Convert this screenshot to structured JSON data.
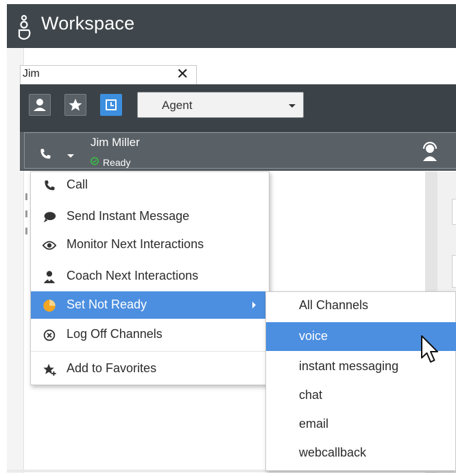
{
  "header": {
    "title": "Workspace",
    "logo_icon": "genesys-logo-icon"
  },
  "search": {
    "value": "Jim",
    "clear_label": "✕"
  },
  "team_communicator": {
    "buttons": [
      "contacts-icon",
      "favorites-icon",
      "recent-icon"
    ],
    "filter": {
      "selected": "Agent"
    }
  },
  "contact": {
    "name": "Jim Miller",
    "status": "Ready",
    "status_color": "#39b54a"
  },
  "context_menu": {
    "items": [
      {
        "label": "Call",
        "icon": "phone-icon"
      },
      {
        "label": "Send Instant Message",
        "icon": "chat-bubble-icon"
      },
      {
        "label": "Monitor Next Interactions",
        "icon": "eye-icon"
      },
      {
        "label": "Coach Next Interactions",
        "icon": "coach-icon"
      },
      {
        "label": "Set Not Ready",
        "icon": "not-ready-clock-icon",
        "highlighted": true
      },
      {
        "label": "Log Off Channels",
        "icon": "log-off-icon"
      },
      {
        "label": "Add to Favorites",
        "icon": "add-favorite-icon"
      }
    ]
  },
  "sub_menu": {
    "items": [
      "All Channels",
      "voice",
      "instant messaging",
      "chat",
      "email",
      "webcallback"
    ],
    "highlighted": "voice"
  },
  "colors": {
    "header": "#3f474c",
    "accent": "#4c8fe0",
    "not_ready": "#f5a623"
  }
}
